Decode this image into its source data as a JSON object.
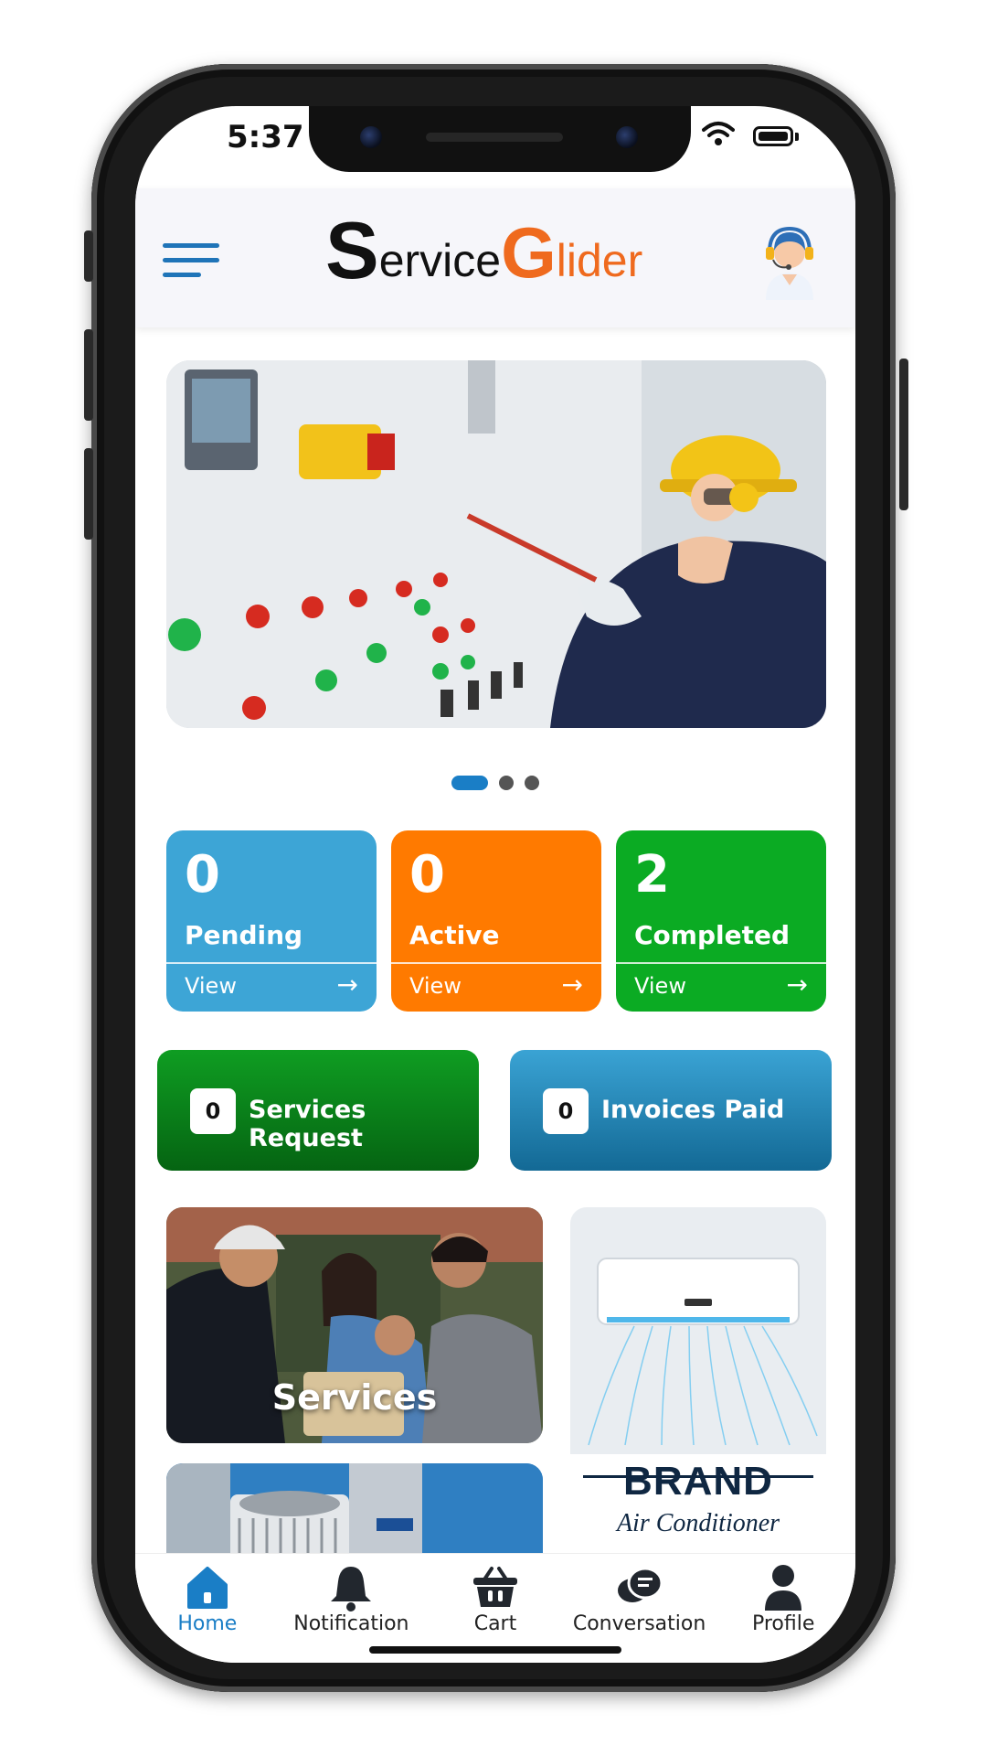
{
  "status_bar": {
    "time": "5:37"
  },
  "app": {
    "logo_first": "S",
    "logo_mid": "ervice",
    "logo_g": "G",
    "logo_rest": "lider"
  },
  "carousel": {
    "slides": 3,
    "active": 0
  },
  "stats": [
    {
      "value": "0",
      "label": "Pending",
      "action": "View",
      "color": "#3da5d6"
    },
    {
      "value": "0",
      "label": "Active",
      "action": "View",
      "color": "#ff7a00"
    },
    {
      "value": "2",
      "label": "Completed",
      "action": "View",
      "color": "#0bab23"
    }
  ],
  "summary": [
    {
      "count": "0",
      "label": "Services Request",
      "color": "#0a8a1a"
    },
    {
      "count": "0",
      "label": "Invoices Paid",
      "color": "#1e86b8"
    }
  ],
  "cards": {
    "services": "Services",
    "ac_brand": "BRAND",
    "ac_sub": "Air Conditioner"
  },
  "nav": [
    {
      "label": "Home",
      "icon": "home-icon",
      "active": true
    },
    {
      "label": "Notification",
      "icon": "bell-icon",
      "active": false
    },
    {
      "label": "Cart",
      "icon": "cart-icon",
      "active": false
    },
    {
      "label": "Conversation",
      "icon": "chat-icon",
      "active": false
    },
    {
      "label": "Profile",
      "icon": "profile-icon",
      "active": false
    }
  ],
  "colors": {
    "accent": "#1a7ec6",
    "logo_orange": "#ef6a1e"
  }
}
